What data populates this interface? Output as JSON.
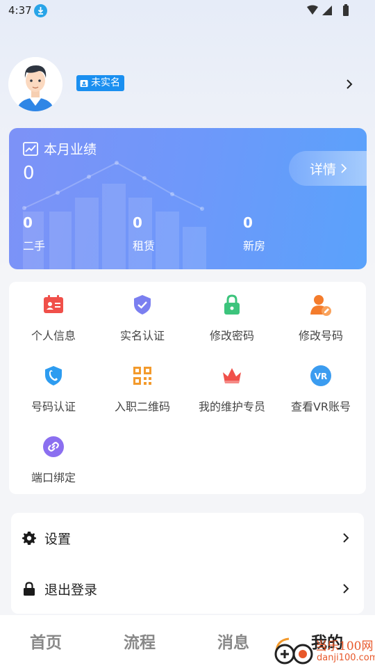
{
  "status_bar": {
    "time": "4:37"
  },
  "profile": {
    "badge_label": "未实名"
  },
  "performance": {
    "title": "本月业绩",
    "total": "0",
    "detail_label": "详情",
    "stats": [
      {
        "value": "0",
        "label": "二手"
      },
      {
        "value": "0",
        "label": "租赁"
      },
      {
        "value": "0",
        "label": "新房"
      }
    ]
  },
  "functions": [
    {
      "label": "个人信息",
      "icon": "id-card-icon",
      "color": "#f0504a"
    },
    {
      "label": "实名认证",
      "icon": "shield-check-icon",
      "color": "#7b7ff0"
    },
    {
      "label": "修改密码",
      "icon": "lock-icon",
      "color": "#3cc47c"
    },
    {
      "label": "修改号码",
      "icon": "user-edit-icon",
      "color": "#f47c2c"
    },
    {
      "label": "号码认证",
      "icon": "phone-shield-icon",
      "color": "#2d9cf0"
    },
    {
      "label": "入职二维码",
      "icon": "qr-code-icon",
      "color": "#f39a2c"
    },
    {
      "label": "我的维护专员",
      "icon": "crown-icon",
      "color": "#f0504a"
    },
    {
      "label": "查看VR账号",
      "icon": "vr-icon",
      "color": "#3b9cf0"
    },
    {
      "label": "端口绑定",
      "icon": "link-icon",
      "color": "#8b6ff0"
    }
  ],
  "menu": [
    {
      "label": "设置",
      "icon": "gear-icon"
    },
    {
      "label": "退出登录",
      "icon": "lock-icon"
    }
  ],
  "tabs": [
    {
      "label": "首页"
    },
    {
      "label": "流程"
    },
    {
      "label": "消息"
    },
    {
      "label": "我的",
      "active": true
    }
  ],
  "watermark": {
    "line1": "当乐100网",
    "line2": "danji100.com"
  }
}
